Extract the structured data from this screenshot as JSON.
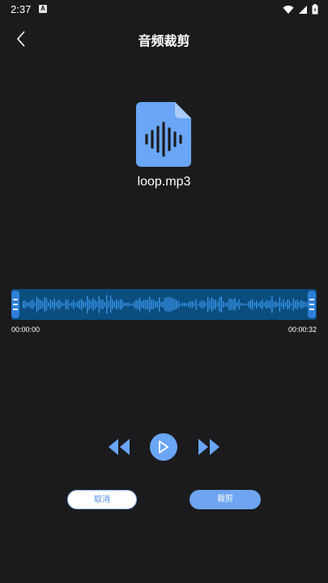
{
  "status_bar": {
    "time": "2:37",
    "notif_letter": "A"
  },
  "header": {
    "title": "音频裁剪"
  },
  "file": {
    "name": "loop.mp3",
    "icon": "audio-file-icon"
  },
  "waveform": {
    "start_time": "00:00:00",
    "end_time": "00:00:32",
    "selection_start": 0.0,
    "selection_end": 1.0
  },
  "controls": {
    "rewind_icon": "rewind-icon",
    "play_icon": "play-icon",
    "forward_icon": "fast-forward-icon"
  },
  "buttons": {
    "cancel_label": "取消",
    "cut_label": "裁剪"
  },
  "colors": {
    "accent": "#6aa6f5",
    "wave_bg": "#0b4d7f",
    "wave_bars": "#3b9af0",
    "background": "#1b1b1d"
  }
}
